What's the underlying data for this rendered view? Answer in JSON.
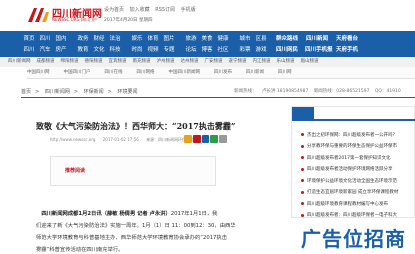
{
  "header": {
    "logo_text": "四川新闻网",
    "logo_sub": "NEWSSC.ORG  四川门户",
    "links": [
      "设为首页",
      "加入收藏",
      "RSS订阅",
      "手机版"
    ],
    "date": "2017年4月20日 星期四"
  },
  "nav": {
    "row1": [
      {
        "items": [
          "首页",
          "四川",
          "国内"
        ],
        "bold": false
      },
      {
        "items": [
          "政务",
          "财经",
          "法治"
        ],
        "bold": false
      },
      {
        "items": [
          "娱乐",
          "体育",
          "图片"
        ],
        "bold": false
      },
      {
        "items": [
          "旅游",
          "美食",
          "健康"
        ],
        "bold": false
      },
      {
        "items": [
          "城市",
          "区县"
        ],
        "bold": false
      },
      {
        "items": [
          "群众路线"
        ],
        "bold": true
      },
      {
        "items": [
          "四川新闻"
        ],
        "bold": true
      },
      {
        "items": [
          "天府看台"
        ],
        "bold": true
      }
    ],
    "row2": [
      {
        "items": [
          "四川",
          "汽车",
          "房产"
        ],
        "bold": false
      },
      {
        "items": [
          "教育",
          "文化",
          "科技"
        ],
        "bold": false
      },
      {
        "items": [
          "时尚",
          "视频",
          "专题"
        ],
        "bold": false
      },
      {
        "items": [
          "论坛",
          "博客",
          "社区"
        ],
        "bold": false
      },
      {
        "items": [
          "彩票",
          "游戏"
        ],
        "bold": false
      },
      {
        "items": [
          "四川网民"
        ],
        "bold": true
      },
      {
        "items": [
          "四川手机报"
        ],
        "bold": true
      },
      {
        "items": [
          "天府手机"
        ],
        "bold": true
      }
    ]
  },
  "channels": [
    "四川新闻网",
    "成都频道",
    "绵阳频道",
    "德阳频道",
    "宜宾频道",
    "南充频道",
    "泸州频道",
    "达州频道",
    "广安频道",
    "遂宁频道",
    "内江频道",
    "乐山频道",
    "眉山频道"
  ],
  "ad_band": [
    "中国四川网",
    "中国四川门户",
    "四川在线",
    "四川网络",
    "中国四川新闻网",
    "四川发布",
    "四川新闻",
    "四川网"
  ],
  "breadcrumbs": [
    "首页",
    "四川新闻网",
    "环保新闻",
    "环境要闻"
  ],
  "hotline": [
    "新闻热线：",
    "卢长洪 18190854987",
    "新闻热线：028-86521597",
    "QQ：41910"
  ],
  "article": {
    "title": "致敬《大气污染防治法》！西华师大：“2017执击雾霾”",
    "meta": [
      "http://www.newssc.org",
      "2017-01-02 17:56",
      "来源：四川新闻网环保频道"
    ],
    "reco_label": "推荐阅读",
    "body": [
      {
        "lead": "四川新闻网成都1月2日讯（薛敏 杨倩男 记者 卢永洪）",
        "text": "2017年1月1日，我"
      },
      {
        "lead": "",
        "text": "们迎来了新《大气污染防治法》实施一周年。1月（1）日 11：00到12：30，由西华"
      },
      {
        "lead": "",
        "text": "师范大学环境教育与科普基地主办、西华师范大学环境教育协会承办的“2017执击"
      },
      {
        "lead": "",
        "text": "雾霾”科普宣传活动在四川南充举行。"
      }
    ]
  },
  "sidebar": {
    "items": [
      "杰出之初环保网：四川超级发布者一公开吗？",
      "分享教环保与重要的环保生态保护公益环保市",
      "四川超级发布者2017第一套保护知识文化",
      "四川超级发布者活动保护环境网络活跃分享",
      "环境保护公益环境文化活动全国生态环境示范",
      "打造生态宜居环境新家园 成立享环保课程教材",
      "四川超级环境教育课程教材编写中心发布",
      "四川超级发布者：四川超级环保者一电子科大",
      "杰出之初环保网：四川超级发布者一"
    ]
  },
  "bigad": {
    "text": "广告位招商"
  },
  "colors": {
    "brand_blue": "#1a5fa8",
    "brand_red": "#c4161c"
  }
}
